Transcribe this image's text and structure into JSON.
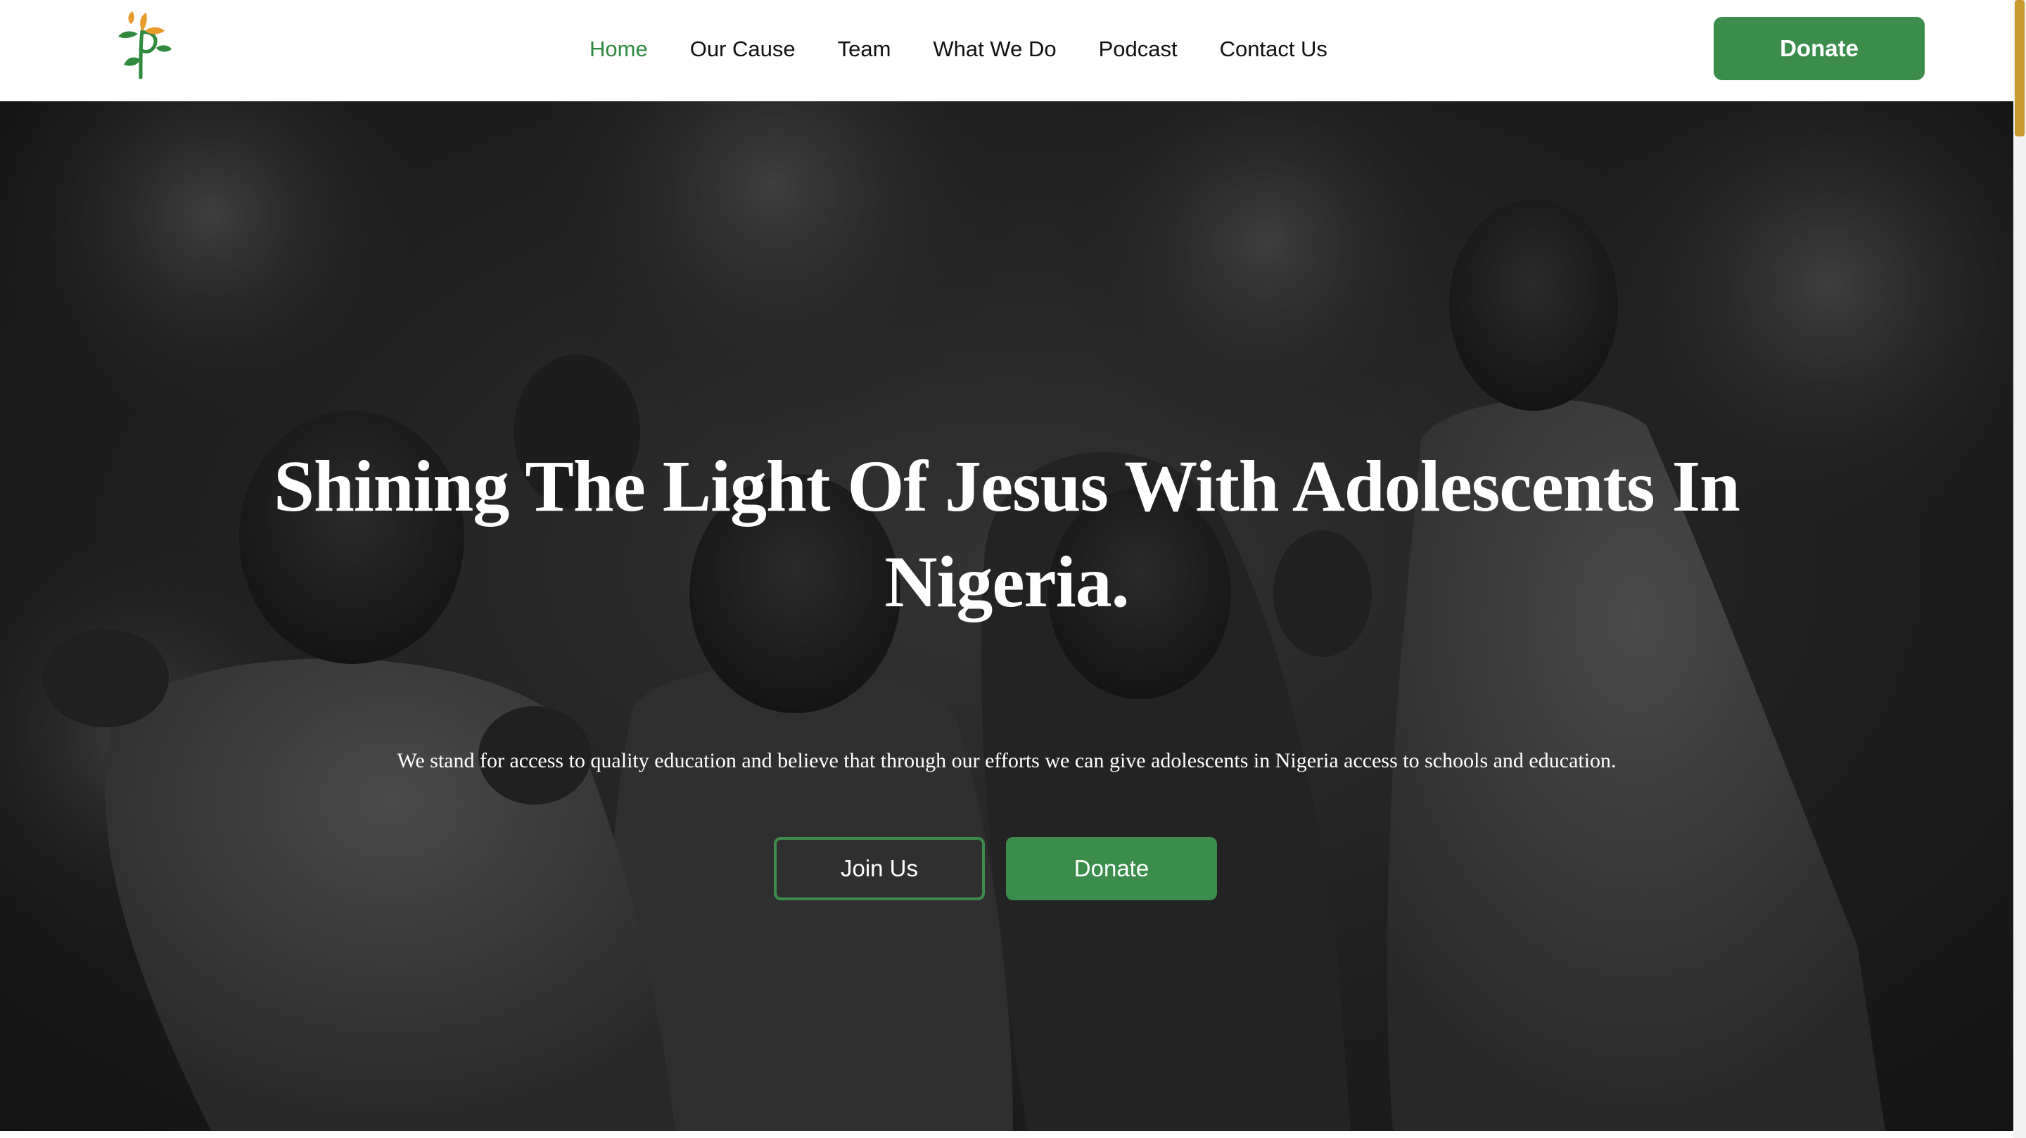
{
  "header": {
    "logo_icon": "tree-p-logo-icon",
    "nav": [
      {
        "label": "Home",
        "active": true
      },
      {
        "label": "Our Cause",
        "active": false
      },
      {
        "label": "Team",
        "active": false
      },
      {
        "label": "What We Do",
        "active": false
      },
      {
        "label": "Podcast",
        "active": false
      },
      {
        "label": "Contact Us",
        "active": false
      }
    ],
    "donate_label": "Donate"
  },
  "hero": {
    "title": "Shining The Light Of Jesus With Adolescents In Nigeria.",
    "subtitle": "We stand for access to quality education and believe that through our efforts we can give adolescents in Nigeria access to schools and education.",
    "join_label": "Join Us",
    "donate_label": "Donate",
    "background_image": "grayscale-photo-smiling-children"
  },
  "colors": {
    "brand_green": "#3c8d4c",
    "nav_active": "#2f8a3e",
    "logo_orange": "#e89b2a",
    "scroll_thumb": "#c99a2e"
  }
}
